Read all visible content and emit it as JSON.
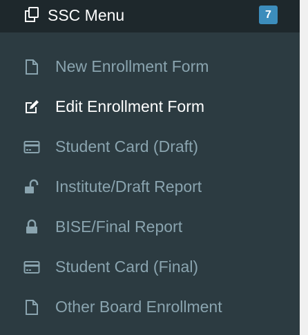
{
  "header": {
    "title": "SSC Menu",
    "badge": "7",
    "icon": "copy-icon"
  },
  "items": [
    {
      "label": "New Enrollment Form",
      "icon": "file-icon",
      "active": false
    },
    {
      "label": "Edit Enrollment Form",
      "icon": "edit-icon",
      "active": true
    },
    {
      "label": "Student Card (Draft)",
      "icon": "credit-card-icon",
      "active": false
    },
    {
      "label": "Institute/Draft Report",
      "icon": "unlock-icon",
      "active": false
    },
    {
      "label": "BISE/Final Report",
      "icon": "lock-icon",
      "active": false
    },
    {
      "label": "Student Card (Final)",
      "icon": "credit-card-icon",
      "active": false
    },
    {
      "label": "Other Board Enrollment",
      "icon": "file-icon",
      "active": false
    }
  ],
  "colors": {
    "sidebar_bg": "#2c3b41",
    "header_bg": "#1e282c",
    "item_text": "#8aa4af",
    "active_text": "#ffffff",
    "badge_bg": "#3c8dbc"
  }
}
